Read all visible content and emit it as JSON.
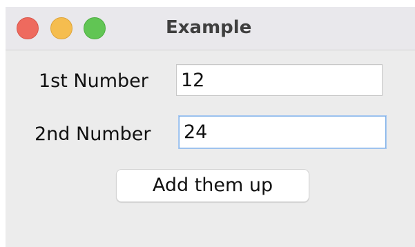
{
  "window": {
    "title": "Example",
    "traffic_lights": [
      {
        "name": "close",
        "color": "#ee6a5e"
      },
      {
        "name": "minimize",
        "color": "#f5bd4f"
      },
      {
        "name": "zoom",
        "color": "#61c554"
      }
    ]
  },
  "form": {
    "first": {
      "label": "1st Number",
      "value": "12"
    },
    "second": {
      "label": "2nd Number",
      "value": "24",
      "focused": true
    },
    "button_label": "Add them up"
  },
  "colors": {
    "focus_ring": "#7fb0e8",
    "window_background": "#ececec"
  }
}
